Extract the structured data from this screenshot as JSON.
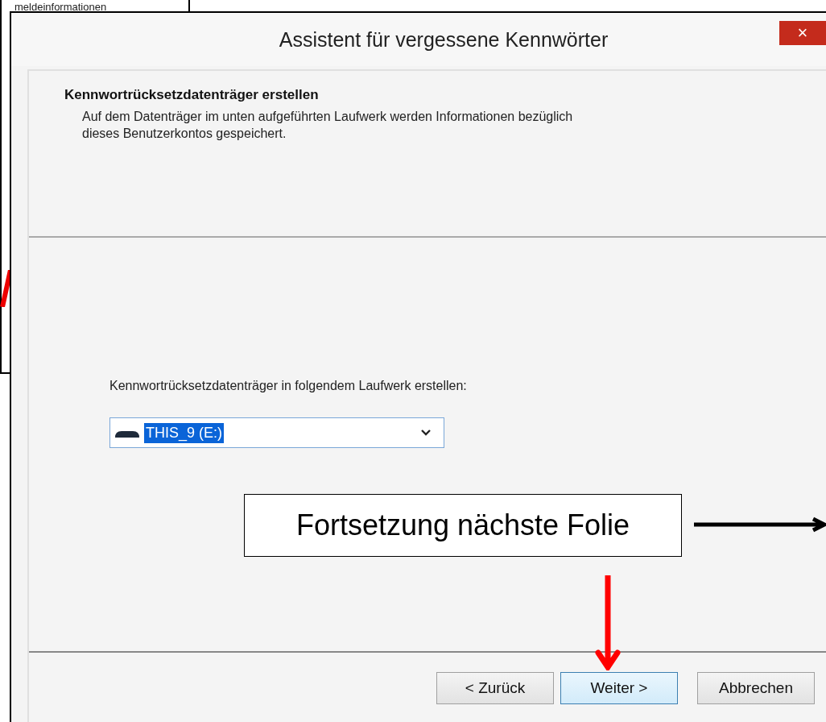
{
  "background_window": {
    "heading": "meldeinformationen"
  },
  "dialog": {
    "title": "Assistent für vergessene Kennwörter",
    "close": "×",
    "header": {
      "title": "Kennwortrücksetzdatenträger erstellen",
      "description": "Auf dem Datenträger im unten aufgeführten Laufwerk werden Informationen bezüglich dieses Benutzerkontos gespeichert."
    },
    "drive_label": "Kennwortrücksetzdatenträger in folgendem Laufwerk erstellen:",
    "drive_select": {
      "value": "THIS_9 (E:)",
      "selected": true
    },
    "buttons": [
      {
        "label": "< Zurück",
        "selected": false
      },
      {
        "label": "Weiter >",
        "selected": true
      },
      {
        "label": "Abbrechen",
        "selected": false
      }
    ]
  },
  "callout": {
    "text": "Fortsetzung nächste Folie"
  }
}
